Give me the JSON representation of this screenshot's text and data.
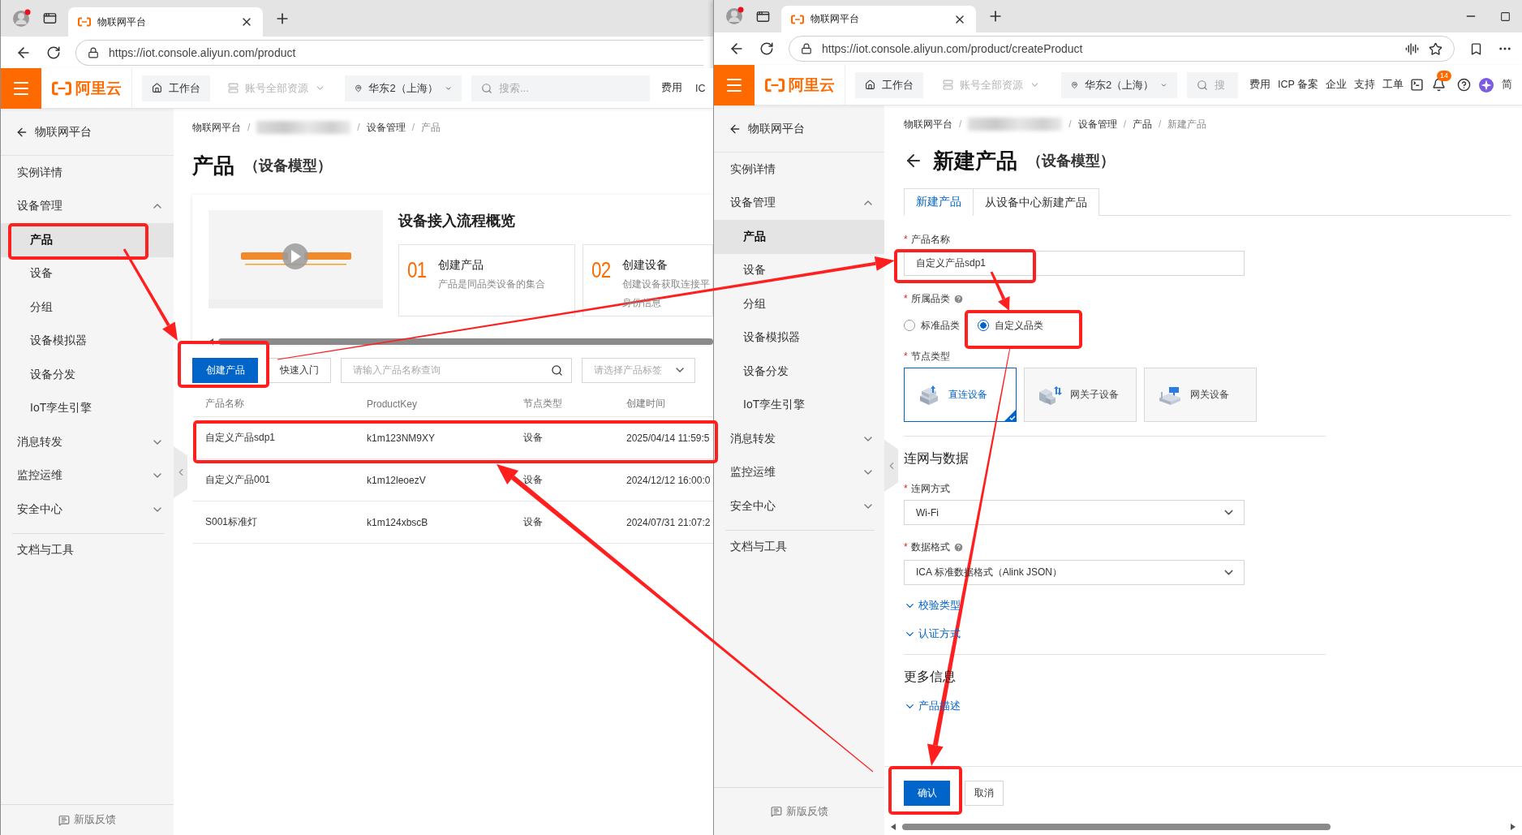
{
  "left_window": {
    "tab": {
      "title": "物联网平台"
    },
    "url": "https://iot.console.aliyun.com/product",
    "topbar": {
      "logo": "阿里云",
      "workbench": "工作台",
      "resources": {
        "label": "账号全部资源",
        "disabled": true
      },
      "region": "华东2（上海）",
      "search_placeholder": "搜索...",
      "links": [
        "费用",
        "IC"
      ]
    },
    "sidebar": {
      "back": "物联网平台",
      "items": [
        {
          "kind": "item",
          "label": "实例详情",
          "selected": false
        },
        {
          "kind": "group",
          "label": "设备管理",
          "expanded": true,
          "children": [
            {
              "label": "产品",
              "selected": true
            },
            {
              "label": "设备",
              "selected": false
            },
            {
              "label": "分组",
              "selected": false
            },
            {
              "label": "设备模拟器",
              "selected": false
            },
            {
              "label": "设备分发",
              "selected": false
            },
            {
              "label": "IoT孪生引擎",
              "selected": false
            }
          ]
        },
        {
          "kind": "group",
          "label": "消息转发",
          "expanded": false
        },
        {
          "kind": "group",
          "label": "监控运维",
          "expanded": false
        },
        {
          "kind": "group",
          "label": "安全中心",
          "expanded": false
        }
      ],
      "tools": "文档与工具",
      "feedback": "新版反馈"
    },
    "breadcrumb": {
      "separator": "/",
      "items": [
        {
          "kind": "link",
          "label": "物联网平台"
        },
        {
          "kind": "redacted"
        },
        {
          "kind": "link",
          "label": "设备管理"
        },
        {
          "kind": "current",
          "label": "产品"
        }
      ]
    },
    "title": "产品",
    "subtitle": "（设备模型）",
    "overview": {
      "title": "设备接入流程概览",
      "steps": [
        {
          "number": "01",
          "title": "创建产品",
          "desc": [
            "产品是同品类设备的集合"
          ]
        },
        {
          "number": "02",
          "title": "创建设备",
          "desc": [
            "创建设备获取连接平",
            "身份信息"
          ]
        }
      ]
    },
    "toolbar": {
      "create": "创建产品",
      "quickstart": "快速入门",
      "search_placeholder": "请输入产品名称查询",
      "tag_placeholder": "请选择产品标签"
    },
    "table": {
      "columns": [
        "产品名称",
        "ProductKey",
        "节点类型",
        "创建时间"
      ],
      "rows": [
        [
          "自定义产品sdp1",
          "k1m123NM9XY",
          "设备",
          "2025/04/14 11:59:5"
        ],
        [
          "自定义产品001",
          "k1m12leoezV",
          "设备",
          "2024/12/12 16:00:0"
        ],
        [
          "S001标准灯",
          "k1m124xbscB",
          "设备",
          "2024/07/31 21:07:2"
        ]
      ]
    }
  },
  "right_window": {
    "tab": {
      "title": "物联网平台"
    },
    "url": "https://iot.console.aliyun.com/product/createProduct",
    "topbar": {
      "logo": "阿里云",
      "workbench": "工作台",
      "resources": {
        "label": "账号全部资源",
        "disabled": true
      },
      "region": "华东2（上海）",
      "search_placeholder": "搜",
      "links": [
        "费用",
        "ICP 备案",
        "企业",
        "支持",
        "工单"
      ],
      "notifications": "14",
      "language": "简"
    },
    "sidebar": {
      "back": "物联网平台",
      "items": [
        {
          "kind": "item",
          "label": "实例详情",
          "selected": false
        },
        {
          "kind": "group",
          "label": "设备管理",
          "expanded": true,
          "children": [
            {
              "label": "产品",
              "selected": true
            },
            {
              "label": "设备",
              "selected": false
            },
            {
              "label": "分组",
              "selected": false
            },
            {
              "label": "设备模拟器",
              "selected": false
            },
            {
              "label": "设备分发",
              "selected": false
            },
            {
              "label": "IoT孪生引擎",
              "selected": false
            }
          ]
        },
        {
          "kind": "group",
          "label": "消息转发",
          "expanded": false
        },
        {
          "kind": "group",
          "label": "监控运维",
          "expanded": false
        },
        {
          "kind": "group",
          "label": "安全中心",
          "expanded": false
        }
      ],
      "tools": "文档与工具",
      "feedback": "新版反馈"
    },
    "breadcrumb": {
      "separator": "/",
      "items": [
        {
          "kind": "link",
          "label": "物联网平台"
        },
        {
          "kind": "redacted"
        },
        {
          "kind": "link",
          "label": "设备管理"
        },
        {
          "kind": "link",
          "label": "产品"
        },
        {
          "kind": "current",
          "label": "新建产品"
        }
      ]
    },
    "title": "新建产品",
    "subtitle": "（设备模型）",
    "tabs": [
      {
        "label": "新建产品",
        "selected": true
      },
      {
        "label": "从设备中心新建产品",
        "selected": false
      }
    ],
    "form": {
      "name": {
        "required_mark": "*",
        "label": "产品名称",
        "value": "自定义产品sdp1"
      },
      "category": {
        "required_mark": "*",
        "label": "所属品类",
        "help": true,
        "options": [
          {
            "label": "标准品类",
            "selected": false
          },
          {
            "label": "自定义品类",
            "selected": true
          }
        ]
      },
      "node_type": {
        "required_mark": "*",
        "label": "节点类型",
        "options": [
          {
            "kind": "direct",
            "label": "直连设备",
            "selected": true
          },
          {
            "kind": "subdevice",
            "label": "网关子设备",
            "selected": false
          },
          {
            "kind": "gateway",
            "label": "网关设备",
            "selected": false
          }
        ]
      },
      "network_section": "连网与数据",
      "network": {
        "required_mark": "*",
        "label": "连网方式",
        "value": "Wi-Fi"
      },
      "data_format": {
        "required_mark": "*",
        "label": "数据格式",
        "help": true,
        "value": "ICA 标准数据格式（Alink JSON）"
      },
      "expanders": [
        "校验类型",
        "认证方式"
      ],
      "more_section": "更多信息",
      "more_expanders": [
        "产品描述"
      ]
    },
    "footer": {
      "confirm": "确认",
      "cancel": "取消"
    }
  }
}
